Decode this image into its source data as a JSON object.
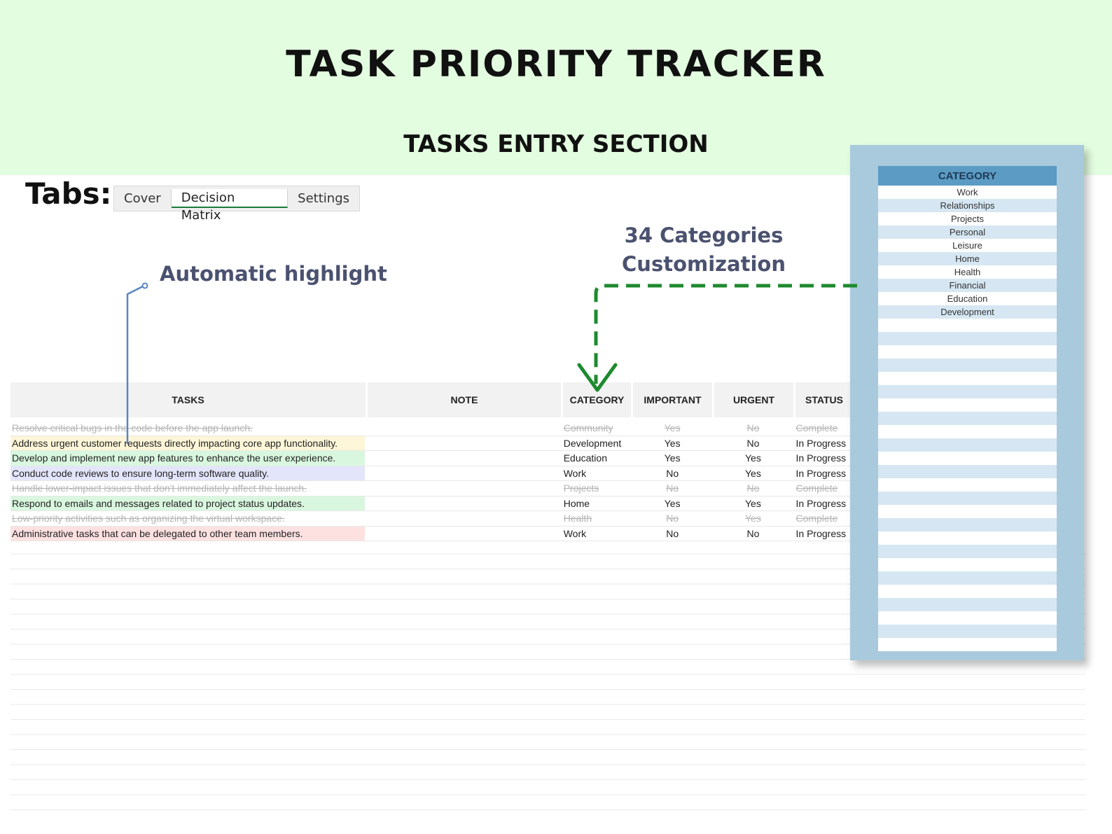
{
  "header": {
    "title": "TASK PRIORITY TRACKER",
    "subtitle": "TASKS ENTRY SECTION"
  },
  "tabs": {
    "label": "Tabs:",
    "items": [
      "Cover",
      "Decision Matrix",
      "Settings"
    ],
    "active": "Decision Matrix"
  },
  "callouts": {
    "highlight": "Automatic highlight",
    "categories_line1": "34 Categories",
    "categories_line2": "Customization"
  },
  "table": {
    "headers": [
      "TASKS",
      "NOTE",
      "CATEGORY",
      "IMPORTANT",
      "URGENT",
      "STATUS"
    ],
    "rows": [
      {
        "task": "Resolve critical bugs in the code before the app launch.",
        "note": "",
        "category": "Community",
        "important": "Yes",
        "urgent": "No",
        "status": "Complete",
        "highlight": "",
        "done": true
      },
      {
        "task": "Address urgent customer requests directly impacting core app functionality.",
        "note": "",
        "category": "Development",
        "important": "Yes",
        "urgent": "No",
        "status": "In Progress",
        "highlight": "#fdf6d8",
        "done": false
      },
      {
        "task": "Develop and implement new app features to enhance the user experience.",
        "note": "",
        "category": "Education",
        "important": "Yes",
        "urgent": "Yes",
        "status": "In Progress",
        "highlight": "#d9f7df",
        "done": false
      },
      {
        "task": "Conduct code reviews to ensure long-term software quality.",
        "note": "",
        "category": "Work",
        "important": "No",
        "urgent": "Yes",
        "status": "In Progress",
        "highlight": "#e3e5fb",
        "done": false
      },
      {
        "task": "Handle lower-impact issues that don't immediately affect the launch.",
        "note": "",
        "category": "Projects",
        "important": "No",
        "urgent": "No",
        "status": "Complete",
        "highlight": "",
        "done": true
      },
      {
        "task": "Respond to emails and messages related to project status updates.",
        "note": "",
        "category": "Home",
        "important": "Yes",
        "urgent": "Yes",
        "status": "In Progress",
        "highlight": "#d9f7df",
        "done": false
      },
      {
        "task": "Low-priority activities such as organizing the virtual workspace.",
        "note": "",
        "category": "Health",
        "important": "No",
        "urgent": "Yes",
        "status": "Complete",
        "highlight": "",
        "done": true
      },
      {
        "task": "Administrative tasks that can be delegated to other team members.",
        "note": "",
        "category": "Work",
        "important": "No",
        "urgent": "No",
        "status": "In Progress",
        "highlight": "#fde1e1",
        "done": false
      }
    ]
  },
  "category_panel": {
    "header": "CATEGORY",
    "items": [
      "Work",
      "Relationships",
      "Projects",
      "Personal",
      "Leisure",
      "Home",
      "Health",
      "Financial",
      "Education",
      "Development"
    ]
  },
  "colors": {
    "banner": "#e3fde0",
    "callout_text": "#4b5270",
    "arrow_green": "#1e8a2e",
    "pointer_blue": "#5a86c0",
    "panel_bg": "#a9c9dd",
    "panel_header": "#5b9bc4"
  }
}
